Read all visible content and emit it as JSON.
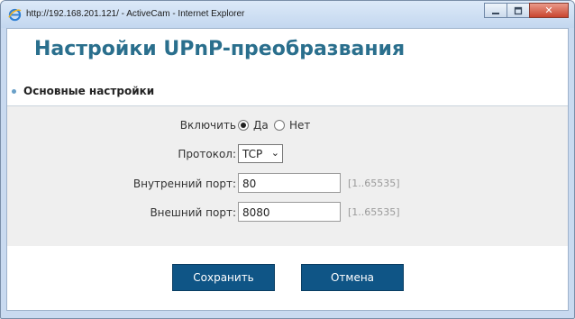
{
  "window": {
    "title": "http://192.168.201.121/ - ActiveCam - Internet Explorer",
    "controls": {
      "minimize": "minimize-icon",
      "maximize": "maximize-icon",
      "close": "close-icon"
    }
  },
  "page": {
    "title": "Настройки UPnP-преобразвания",
    "section": "Основные настройки"
  },
  "form": {
    "enable": {
      "label": "Включить",
      "yes": "Да",
      "no": "Нет",
      "selected": "Да"
    },
    "protocol": {
      "label": "Протокол:",
      "value": "TCP"
    },
    "internal_port": {
      "label": "Внутренний порт:",
      "value": "80",
      "range": "[1..65535]"
    },
    "external_port": {
      "label": "Внешний порт:",
      "value": "8080",
      "range": "[1..65535]"
    }
  },
  "buttons": {
    "save": "Сохранить",
    "cancel": "Отмена"
  },
  "colors": {
    "title": "#2a6f8d",
    "button": "#0f5586",
    "form_bg": "#efefef",
    "chrome": "#c9daf0"
  }
}
